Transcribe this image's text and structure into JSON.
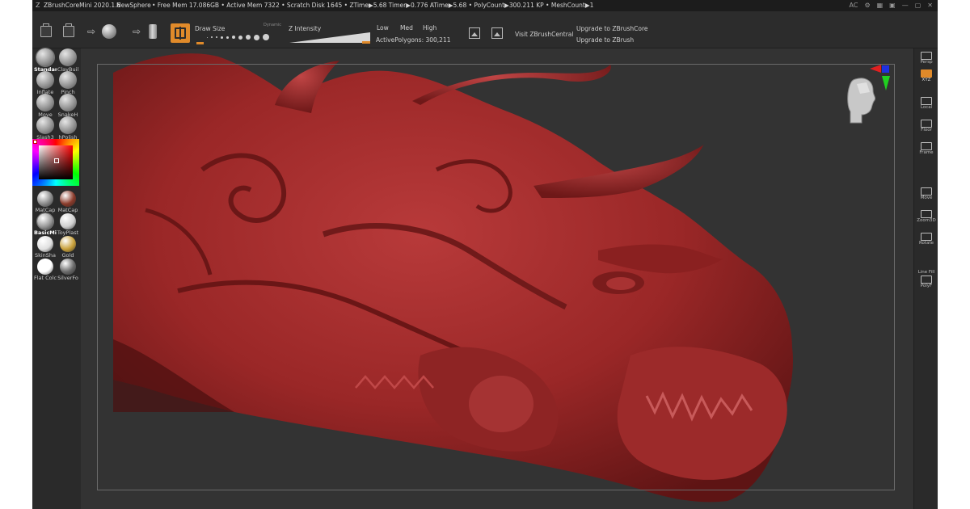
{
  "titlebar": {
    "app_title": "ZBrushCoreMini 2020.1.6",
    "document": "NewSphere",
    "status": "• Free Mem 17.086GB • Active Mem 7322 • Scratch Disk 1645 • ZTime▶5.68 Timer▶0.776 ATime▶5.68 • PolyCount▶300.211 KP • MeshCount▶1",
    "right_text": "AC"
  },
  "shelf": {
    "draw_size_label": "Draw Size",
    "dynamic_label": "Dynamic",
    "z_intensity_label": "Z Intensity",
    "quality": {
      "low": "Low",
      "med": "Med",
      "high": "High"
    },
    "active_polygons": "ActivePolygons: 300,211",
    "visit_label": "Visit ZBrushCentral",
    "upgrade_core": "Upgrade to ZBrushCore",
    "upgrade_zbrush": "Upgrade to ZBrush",
    "draw_size_level": 0.08,
    "z_intensity_level": 0.95
  },
  "brushes": [
    {
      "label": "Standar",
      "selected": true
    },
    {
      "label": "ClayBuil",
      "selected": false
    },
    {
      "label": "Inflate",
      "selected": false
    },
    {
      "label": "Pinch",
      "selected": false
    },
    {
      "label": "Move",
      "selected": false
    },
    {
      "label": "SnakeH",
      "selected": false
    },
    {
      "label": "Slash3",
      "selected": false
    },
    {
      "label": "hPolish",
      "selected": false
    }
  ],
  "materials": [
    {
      "label": "MatCap",
      "selected": false,
      "color": "#8a8a8a"
    },
    {
      "label": "MatCap",
      "selected": false,
      "color": "#8a3a2a"
    },
    {
      "label": "BasicMi",
      "selected": true,
      "color": "#9a9a9a"
    },
    {
      "label": "ToyPlast",
      "selected": false,
      "color": "#cfcfcf"
    },
    {
      "label": "SkinSha",
      "selected": false,
      "color": "#e0e0e0"
    },
    {
      "label": "Gold",
      "selected": false,
      "color": "#c9a13a"
    },
    {
      "label": "Flat Colc",
      "selected": false,
      "color": "#ffffff"
    },
    {
      "label": "SilverFo",
      "selected": false,
      "color": "#6a6a6a"
    }
  ],
  "right_tray": [
    {
      "label": "Persp",
      "icon": "grid-icon",
      "active": false
    },
    {
      "label": "XYZ",
      "icon": "rotate-axis-icon",
      "active": true
    },
    {
      "label": "Local",
      "icon": "local-icon",
      "active": false
    },
    {
      "label": "Floor",
      "icon": "floor-icon",
      "active": false
    },
    {
      "label": "Frame",
      "icon": "frame-icon",
      "active": false
    },
    {
      "label": "Move",
      "icon": "move-hand-icon",
      "active": false
    },
    {
      "label": "Zoom3D",
      "icon": "zoom-icon",
      "active": false
    },
    {
      "label": "Rotate",
      "icon": "rotate-icon",
      "active": false
    },
    {
      "label": "Line Fill",
      "icon": "polyframe-icon",
      "active": false
    },
    {
      "label": "PolyF",
      "icon": "polyframe-icon",
      "active": false
    }
  ],
  "colors": {
    "accent": "#e08a2a",
    "model": "#a02a2a",
    "canvas": "#333333"
  }
}
